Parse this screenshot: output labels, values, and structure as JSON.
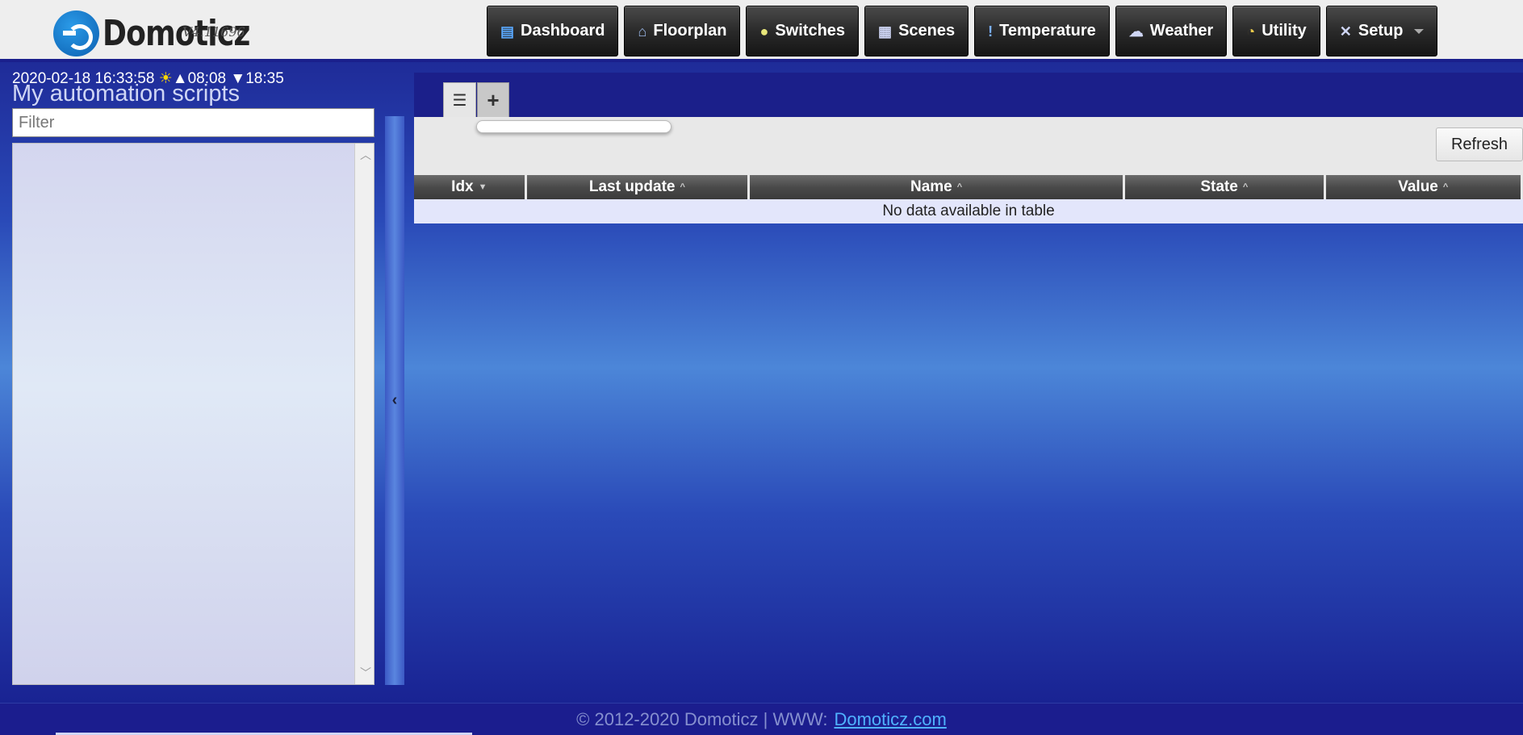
{
  "app": {
    "name": "Domoticz",
    "version": "V4.11696"
  },
  "nav": {
    "items": [
      {
        "label": "Dashboard",
        "icon": "dashboard-icon"
      },
      {
        "label": "Floorplan",
        "icon": "floorplan-icon"
      },
      {
        "label": "Switches",
        "icon": "lightbulb-icon"
      },
      {
        "label": "Scenes",
        "icon": "clapperboard-icon"
      },
      {
        "label": "Temperature",
        "icon": "thermometer-icon"
      },
      {
        "label": "Weather",
        "icon": "rain-cloud-icon"
      },
      {
        "label": "Utility",
        "icon": "gauge-icon"
      },
      {
        "label": "Setup",
        "icon": "tools-icon"
      }
    ]
  },
  "status": {
    "datetime": "2020-02-18 16:33:58",
    "sunrise": "▲08:08",
    "sunset": "▼18:35"
  },
  "left": {
    "title": "My automation scripts",
    "filter_placeholder": "Filter"
  },
  "toolbar": {
    "refresh_label": "Refresh"
  },
  "table": {
    "columns": [
      {
        "label": "Idx",
        "sort": "▼"
      },
      {
        "label": "Last update",
        "sort": "^"
      },
      {
        "label": "Name",
        "sort": "^"
      },
      {
        "label": "State",
        "sort": "^"
      },
      {
        "label": "Value",
        "sort": "^"
      }
    ],
    "empty_message": "No data available in table"
  },
  "footer": {
    "copyright": "© 2012-2020 Domoticz | WWW:",
    "link": "Domoticz.com"
  },
  "colors": {
    "nav_bg": "#2a2a2a",
    "header_bg": "#eeeeee",
    "footer_link": "#4fb2ff"
  }
}
